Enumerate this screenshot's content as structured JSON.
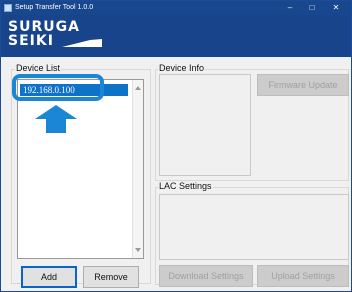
{
  "window": {
    "title": "Setup Transfer Tool 1.0.0"
  },
  "banner": {
    "logo_line1": "SURUGA",
    "logo_line2": "SEIKI"
  },
  "device_list": {
    "label": "Device List",
    "items": [
      {
        "text": "192.168.0.100",
        "selected": true
      }
    ],
    "add_label": "Add",
    "remove_label": "Remove"
  },
  "device_info": {
    "label": "Device Info",
    "firmware_update_label": "Firmware Update"
  },
  "lac_settings": {
    "label": "LAC Settings",
    "download_label": "Download Settings",
    "upload_label": "Upload Settings"
  },
  "colors": {
    "titlebar": "#18478e",
    "banner": "#17448a",
    "selection": "#0e72c9",
    "callout": "#1c86d6"
  },
  "icons": {
    "app": "app-icon",
    "pointer": "up-arrow-icon"
  }
}
